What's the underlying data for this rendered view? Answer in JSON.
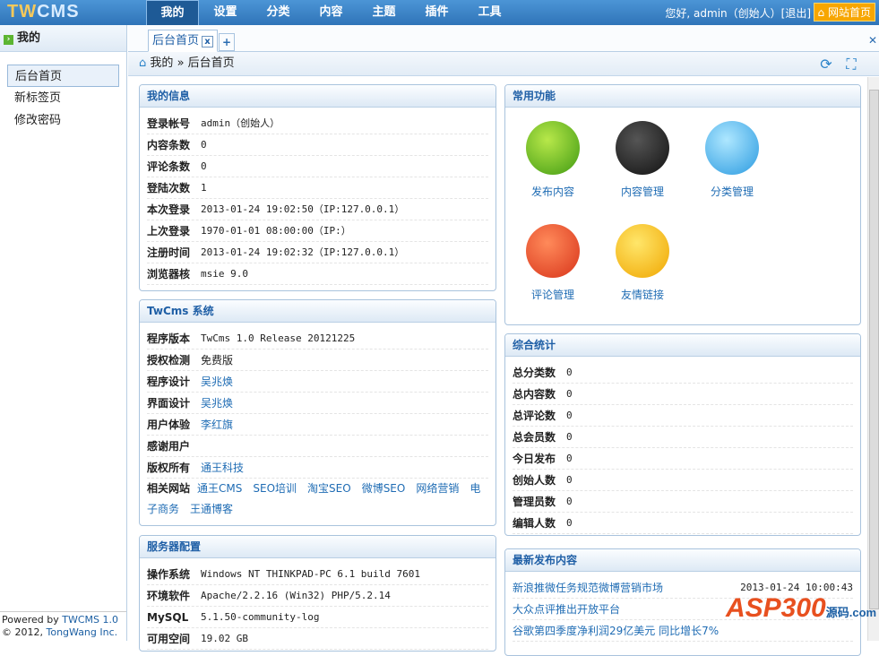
{
  "header": {
    "logo": "TWCMS",
    "nav": [
      "我的",
      "设置",
      "分类",
      "内容",
      "主题",
      "插件",
      "工具"
    ],
    "greeting": "您好, admin（创始人）[退出]",
    "site_home": "网站首页"
  },
  "sidebar": {
    "title": "我的",
    "items": [
      "后台首页",
      "新标签页",
      "修改密码"
    ],
    "footer_line1": "Powered by ",
    "footer_brand": "TWCMS 1.0",
    "footer_line2": "© 2012, ",
    "footer_company": "TongWang Inc."
  },
  "tabs": {
    "active": "后台首页",
    "close": "x",
    "add": "+"
  },
  "breadcrumb": {
    "root": "我的",
    "sep": "»",
    "current": "后台首页"
  },
  "my_info": {
    "title": "我的信息",
    "rows": [
      [
        "登录帐号",
        "admin（创始人）"
      ],
      [
        "内容条数",
        "0"
      ],
      [
        "评论条数",
        "0"
      ],
      [
        "登陆次数",
        "1"
      ],
      [
        "本次登录",
        "2013-01-24 19:02:50（IP:127.0.0.1）"
      ],
      [
        "上次登录",
        "1970-01-01 08:00:00（IP:）"
      ],
      [
        "注册时间",
        "2013-01-24 19:02:32（IP:127.0.0.1）"
      ],
      [
        "浏览器核",
        "msie 9.0"
      ]
    ]
  },
  "system": {
    "title": "TwCms 系统",
    "rows": [
      [
        "程序版本",
        "TwCms 1.0 Release 20121225"
      ],
      [
        "授权检测",
        "免费版"
      ],
      [
        "程序设计",
        "吴兆焕"
      ],
      [
        "界面设计",
        "吴兆焕"
      ],
      [
        "用户体验",
        "李红旗"
      ],
      [
        "感谢用户",
        ""
      ],
      [
        "版权所有",
        "通王科技"
      ]
    ],
    "related_label": "相关网站",
    "related": [
      "通王CMS",
      "SEO培训",
      "淘宝SEO",
      "微博SEO",
      "网络营销",
      "电子商务",
      "王通博客"
    ]
  },
  "server": {
    "title": "服务器配置",
    "rows": [
      [
        "操作系统",
        "Windows NT THINKPAD-PC 6.1 build 7601"
      ],
      [
        "环境软件",
        "Apache/2.2.16 (Win32) PHP/5.2.14"
      ],
      [
        "MySQL",
        "5.1.50-community-log"
      ],
      [
        "可用空间",
        "19.02 GB"
      ]
    ]
  },
  "functions": {
    "title": "常用功能",
    "items": [
      "发布内容",
      "内容管理",
      "分类管理",
      "评论管理",
      "友情链接"
    ]
  },
  "stats": {
    "title": "综合统计",
    "rows": [
      [
        "总分类数",
        "0"
      ],
      [
        "总内容数",
        "0"
      ],
      [
        "总评论数",
        "0"
      ],
      [
        "总会员数",
        "0"
      ],
      [
        "今日发布",
        "0"
      ],
      [
        "创始人数",
        "0"
      ],
      [
        "管理员数",
        "0"
      ],
      [
        "编辑人数",
        "0"
      ]
    ]
  },
  "latest": {
    "title": "最新发布内容",
    "items": [
      [
        "新浪推微任务规范微博营销市场",
        "2013-01-24 10:00:43"
      ],
      [
        "大众点评推出开放平台",
        ""
      ],
      [
        "谷歌第四季度净利润29亿美元 同比增长7%",
        ""
      ]
    ]
  },
  "watermark": {
    "text": "ASP300",
    "sub": "源码.com"
  }
}
